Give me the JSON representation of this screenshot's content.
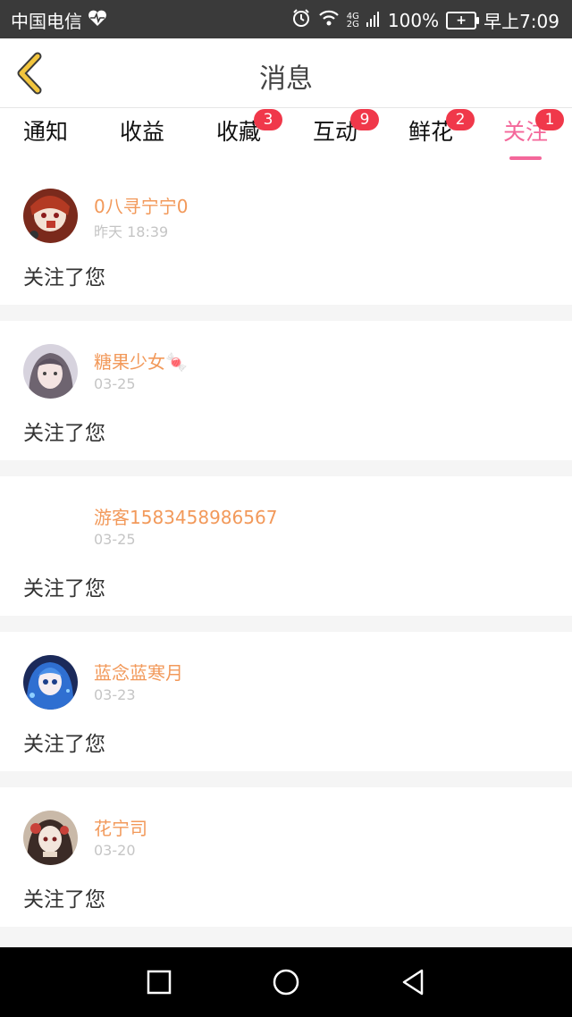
{
  "status_bar": {
    "carrier": "中国电信",
    "network_top": "4G",
    "network_bottom": "2G",
    "battery": "100%",
    "time": "早上7:09"
  },
  "header": {
    "title": "消息"
  },
  "tabs": [
    {
      "label": "通知",
      "badge": "",
      "active": false
    },
    {
      "label": "收益",
      "badge": "",
      "active": false
    },
    {
      "label": "收藏",
      "badge": "3",
      "active": false
    },
    {
      "label": "互动",
      "badge": "9",
      "active": false
    },
    {
      "label": "鲜花",
      "badge": "2",
      "active": false
    },
    {
      "label": "关注",
      "badge": "1",
      "active": true
    }
  ],
  "notifications": [
    {
      "name": "0八寻宁宁0",
      "time": "昨天 18:39",
      "action": "关注了您"
    },
    {
      "name": "糖果少女🍬",
      "time": "03-25",
      "action": "关注了您"
    },
    {
      "name": "游客1583458986567",
      "time": "03-25",
      "action": "关注了您"
    },
    {
      "name": "蓝念蓝寒月",
      "time": "03-23",
      "action": "关注了您"
    },
    {
      "name": "花宁司",
      "time": "03-20",
      "action": "关注了您"
    }
  ],
  "colors": {
    "accent": "#f4679a",
    "badge": "#f0384a",
    "username": "#f2995a",
    "back_arrow": "#f2c53d"
  }
}
